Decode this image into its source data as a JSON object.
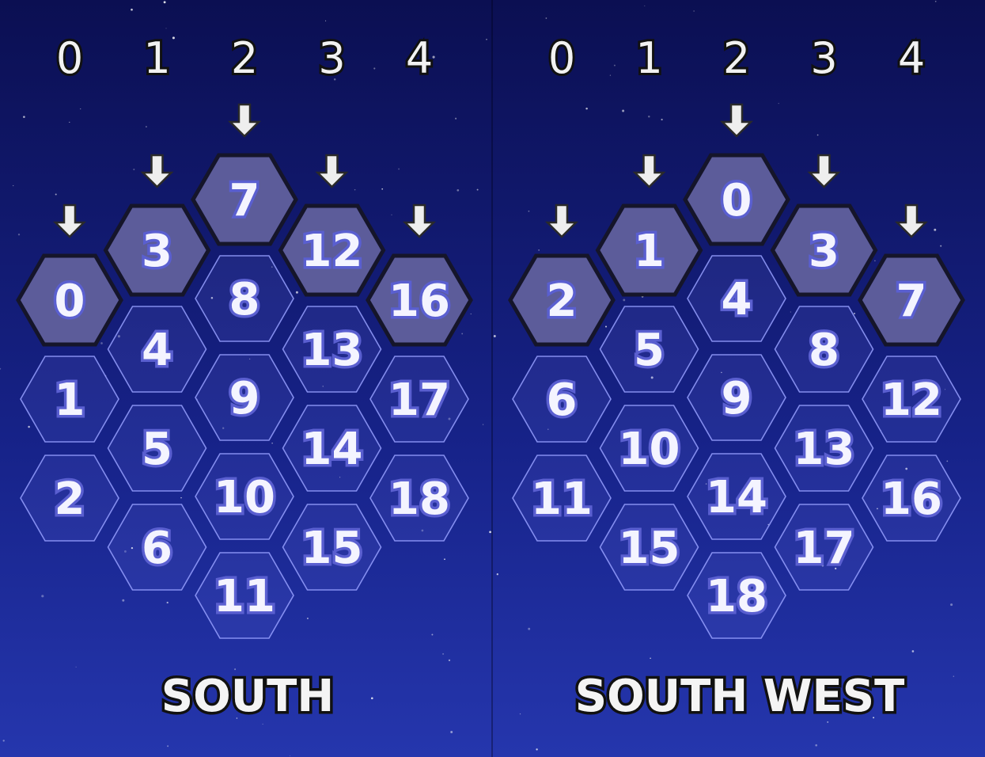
{
  "colors": {
    "background_top": "#0b0f52",
    "background_bottom": "#2233a8",
    "normal_cell_fill": "rgba(110,120,235,0.14)",
    "normal_cell_stroke": "#9aa0ff",
    "highlight_cell_fill": "#5c5c9a",
    "label_outline": "#5a5fd0"
  },
  "panels": [
    {
      "title": "SOUTH",
      "column_numbers": [
        "0",
        "1",
        "2",
        "3",
        "4"
      ],
      "arrow_icon": "arrow-down-icon",
      "columns": [
        [
          "0",
          "1",
          "2"
        ],
        [
          "3",
          "4",
          "5",
          "6"
        ],
        [
          "7",
          "8",
          "9",
          "10",
          "11"
        ],
        [
          "12",
          "13",
          "14",
          "15"
        ],
        [
          "16",
          "17",
          "18"
        ]
      ]
    },
    {
      "title": "SOUTH WEST",
      "column_numbers": [
        "0",
        "1",
        "2",
        "3",
        "4"
      ],
      "arrow_icon": "arrow-down-icon",
      "columns": [
        [
          "2",
          "6",
          "11"
        ],
        [
          "1",
          "5",
          "10",
          "15"
        ],
        [
          "0",
          "4",
          "9",
          "14",
          "18"
        ],
        [
          "3",
          "8",
          "13",
          "17"
        ],
        [
          "7",
          "12",
          "16"
        ]
      ]
    }
  ]
}
